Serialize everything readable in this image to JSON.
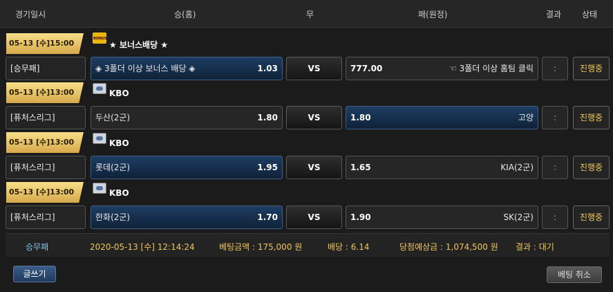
{
  "header": {
    "date": "경기일시",
    "home": "승(홈)",
    "draw": "무",
    "away": "패(원정)",
    "result": "결과",
    "status": "상태"
  },
  "games": [
    {
      "datetime": "05-13 [수]15:00",
      "league_icon": "bonus-logo",
      "league_icon_text": "BONUS",
      "league": "★ 보너스배당 ★",
      "type": "[승무패]",
      "home": "◈ 3폴더 이상 보너스 배당 ◈",
      "home_odds": "1.03",
      "vs": "VS",
      "away_odds": "777.00",
      "away": "☜ 3폴더 이상 홈팀 클릭",
      "result": ":",
      "status": "진행중"
    },
    {
      "datetime": "05-13 [수]13:00",
      "league_icon": "kbo-logo",
      "league": "KBO",
      "type": "[퓨처스리그]",
      "home": "두산(2군)",
      "home_odds": "1.80",
      "vs": "VS",
      "away_odds": "1.80",
      "away": "고양",
      "result": ":",
      "status": "진행중"
    },
    {
      "datetime": "05-13 [수]13:00",
      "league_icon": "kbo-logo",
      "league": "KBO",
      "type": "[퓨처스리그]",
      "home": "롯데(2군)",
      "home_odds": "1.95",
      "vs": "VS",
      "away_odds": "1.65",
      "away": "KIA(2군)",
      "result": ":",
      "status": "진행중"
    },
    {
      "datetime": "05-13 [수]13:00",
      "league_icon": "kbo-logo",
      "league": "KBO",
      "type": "[퓨처스리그]",
      "home": "한화(2군)",
      "home_odds": "1.70",
      "vs": "VS",
      "away_odds": "1.90",
      "away": "SK(2군)",
      "result": ":",
      "status": "진행중"
    }
  ],
  "summary": {
    "type": "승무패",
    "datetime": "2020-05-13 [수] 12:14:24",
    "bet_amount": "베팅금액 : 175,000 원",
    "odds": "배당 : 6.14",
    "expected": "당첨예상금 : 1,074,500 원",
    "result": "결과 : 대기"
  },
  "buttons": {
    "write": "글쓰기",
    "cancel": "베팅 취소"
  },
  "colors": {
    "accent_gold": "#f1c75b",
    "selected_blue": "#1d3d62",
    "date_badge": "#e9c46a"
  }
}
